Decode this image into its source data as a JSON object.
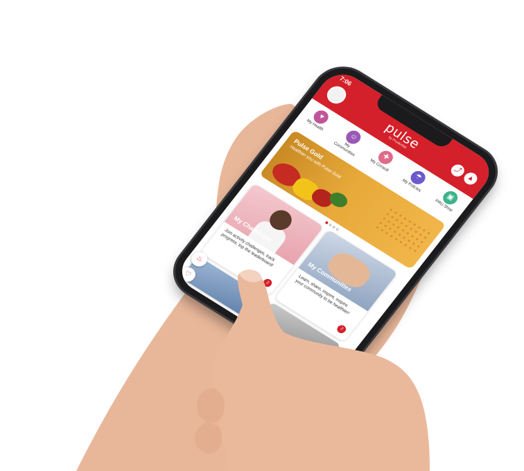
{
  "status_bar": {
    "time": "7:06"
  },
  "header": {
    "brand": "pulse",
    "brand_sub": "by Prudential",
    "share_icon": "share-icon",
    "fire_icon": "fire-icon"
  },
  "nav": {
    "items": [
      {
        "label": "My Health",
        "icon": "heart-icon",
        "color": "#c0569a"
      },
      {
        "label": "My Communities",
        "icon": "people-icon",
        "color": "#9b59b6"
      },
      {
        "label": "My Consult",
        "icon": "doctor-icon",
        "color": "#e06a8a"
      },
      {
        "label": "My Policies",
        "icon": "umbrella-icon",
        "color": "#6a5acd"
      },
      {
        "label": "PRU Shop",
        "icon": "cart-icon",
        "color": "#3cb38a"
      }
    ]
  },
  "banner": {
    "title": "Pulse Gold",
    "text": "Healthier you with Pulse Gold"
  },
  "cards": [
    {
      "title": "My Challenges",
      "desc": "Join activity challenges, track progress, top the leaderboard!",
      "badge": "2"
    },
    {
      "title": "My Communities",
      "desc": "Learn, share, inspire, inspire your community to be healthier!",
      "badge": "2"
    }
  ],
  "colors": {
    "brand": "#d4202a"
  }
}
